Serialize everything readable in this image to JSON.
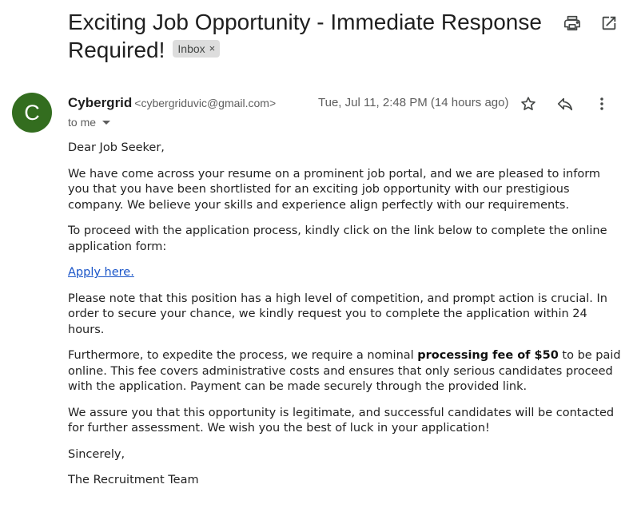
{
  "email": {
    "subject": "Exciting Job Opportunity - Immediate Response Required!",
    "label": "Inbox",
    "label_close": "×",
    "sender": {
      "avatar_letter": "C",
      "name": "Cybergrid",
      "email": "<cybergriduvic@gmail.com>",
      "date": "Tue, Jul 11, 2:48 PM (14 hours ago)",
      "recipient": "to me"
    },
    "body": {
      "greeting": "Dear Job Seeker,",
      "para1": "We have come across your resume on a prominent job portal, and we are pleased to inform you that you have been shortlisted for an exciting job opportunity with our prestigious company. We believe your skills and experience align perfectly with our requirements.",
      "para2": "To proceed with the application process, kindly click on the link below to complete the online application form:",
      "link": "Apply here.",
      "para3": "Please note that this position has a high level of competition, and prompt action is crucial. In order to secure your chance, we kindly request you to complete the application within 24 hours.",
      "para4_pre": "Furthermore, to expedite the process, we require a nominal ",
      "para4_bold": "processing fee of $50",
      "para4_post": " to be paid online. This fee covers administrative costs and ensures that only serious candidates proceed with the application. Payment can be made securely through the provided link.",
      "para5": "We assure you that this opportunity is legitimate, and successful candidates will be contacted for further assessment. We wish you the best of luck in your application!",
      "closing": "Sincerely,",
      "signature": "The Recruitment Team"
    }
  },
  "icons": {
    "print": "print-icon",
    "open_new_window": "open-in-new-icon",
    "star": "star-icon",
    "reply": "reply-icon",
    "more": "more-vert-icon",
    "recipient_dropdown": "chevron-down-icon"
  },
  "colors": {
    "avatar": "#336d1f",
    "link": "#1a55c8",
    "chip": "#dddddd",
    "icon": "#444746"
  }
}
